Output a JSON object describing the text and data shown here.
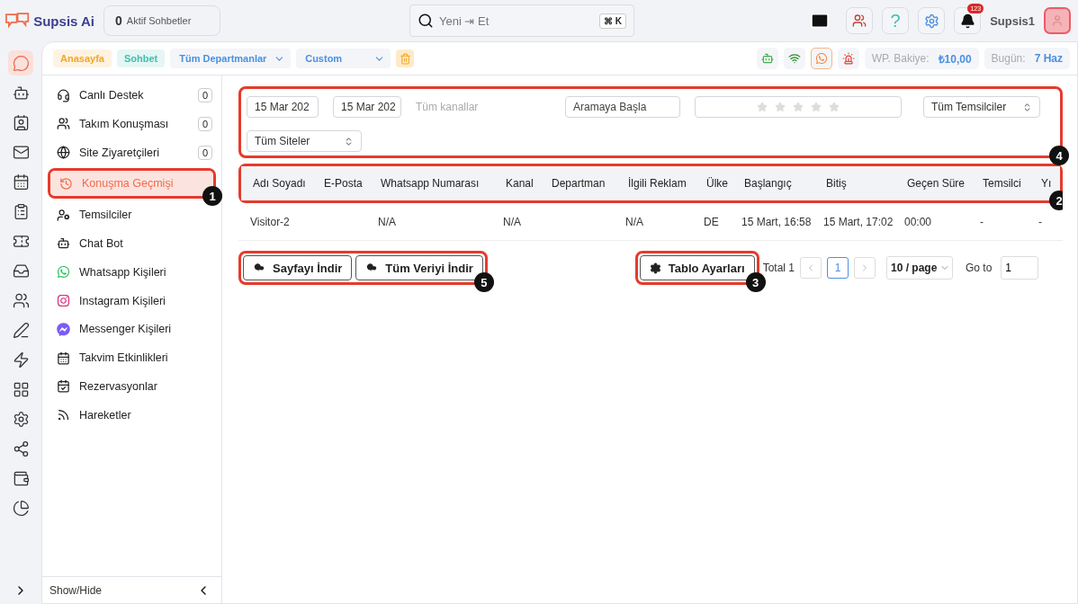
{
  "header": {
    "logo": "Supsis Ai",
    "active_chats": {
      "count": "0",
      "label": "Aktif Sohbetler"
    },
    "search": {
      "value": "Yeni ⇥ Et",
      "shortcut": "⌘ K"
    },
    "help": "?",
    "notifications": "123",
    "user": "Supsis1"
  },
  "rail": [
    {
      "kind": "chat",
      "selected": true
    },
    {
      "kind": "bot",
      "selected": false
    },
    {
      "kind": "contact",
      "selected": false
    },
    {
      "kind": "mail",
      "selected": false
    },
    {
      "kind": "calendar",
      "selected": false
    },
    {
      "kind": "clipboard",
      "selected": false
    },
    {
      "kind": "ticket",
      "selected": false
    },
    {
      "kind": "inbox",
      "selected": false
    },
    {
      "kind": "users",
      "selected": false
    },
    {
      "kind": "pen",
      "selected": false
    },
    {
      "kind": "zap",
      "selected": false
    },
    {
      "kind": "grid",
      "selected": false
    },
    {
      "kind": "settings",
      "selected": false
    },
    {
      "kind": "share",
      "selected": false
    },
    {
      "kind": "wallet",
      "selected": false
    },
    {
      "kind": "chart",
      "selected": false
    }
  ],
  "toolbar": {
    "tags": [
      {
        "label": "Anasayfa",
        "color": "#f5a623"
      },
      {
        "label": "Sohbet",
        "color": "#3fbfad"
      }
    ],
    "dropdowns": [
      "Tüm Departmanlar",
      "Custom"
    ],
    "status_icons": [
      {
        "kind": "bot",
        "selected": false
      },
      {
        "kind": "wifi",
        "selected": false
      },
      {
        "kind": "whatsapp",
        "selected": true
      },
      {
        "kind": "alert",
        "selected": false
      }
    ],
    "balance": {
      "label": "WP. Bakiye:",
      "value": "₺10,00"
    },
    "today": {
      "label": "Bugün:",
      "value": "7 Haz"
    }
  },
  "sidebar": {
    "items": [
      {
        "kind": "headset",
        "label": "Canlı Destek",
        "count": "0",
        "selected": false
      },
      {
        "kind": "team",
        "label": "Takım Konuşması",
        "count": "0",
        "selected": false
      },
      {
        "kind": "globe",
        "label": "Site Ziyaretçileri",
        "count": "0",
        "selected": false
      },
      {
        "kind": "history",
        "label": "Konuşma Geçmişi",
        "selected": true,
        "callout": "1"
      },
      {
        "kind": "agents",
        "label": "Temsilciler",
        "selected": false
      },
      {
        "kind": "bot",
        "label": "Chat Bot",
        "selected": false
      },
      {
        "kind": "whatsapp",
        "label": "Whatsapp Kişileri",
        "selected": false
      },
      {
        "kind": "instagram",
        "label": "Instagram Kişileri",
        "selected": false
      },
      {
        "kind": "messenger",
        "label": "Messenger Kişileri",
        "selected": false
      },
      {
        "kind": "calendar",
        "label": "Takvim Etkinlikleri",
        "selected": false
      },
      {
        "kind": "booking",
        "label": "Rezervasyonlar",
        "selected": false
      },
      {
        "kind": "rss",
        "label": "Hareketler",
        "selected": false
      }
    ],
    "footer": "Show/Hide"
  },
  "filters": {
    "callout": "4",
    "date_from": "15 Mar 202",
    "date_to": "15 Mar 202",
    "channels": "Tüm kanallar",
    "search": {
      "placeholder": "Aramaya Başla"
    },
    "stars": 0,
    "agents": "Tüm Temsilciler",
    "sites": "Tüm Siteler"
  },
  "table": {
    "callout": "2",
    "columns": [
      "Adı Soyadı",
      "E-Posta",
      "Whatsapp Numarası",
      "Kanal",
      "Departman",
      "İlgili Reklam",
      "Ülke",
      "Başlangıç",
      "Bitiş",
      "Geçen Süre",
      "Temsilci",
      "Yı"
    ],
    "rows": [
      [
        "Visitor-2",
        "",
        "N/A",
        "N/A",
        "",
        "N/A",
        "DE",
        "15 Mart, 16:58",
        "15 Mart, 17:02",
        "00:00",
        "-",
        "-"
      ]
    ]
  },
  "downloads": {
    "callout": "5",
    "buttons": [
      "Sayfayı İndir",
      "Tüm Veriyi İndir"
    ]
  },
  "settings_button": {
    "label": "Tablo Ayarları",
    "callout": "3"
  },
  "pagination": {
    "total": "Total 1",
    "pages": [
      {
        "label": "1",
        "selected": true
      }
    ],
    "page_size": "10 / page",
    "goto_label": "Go to",
    "goto_value": "1"
  }
}
